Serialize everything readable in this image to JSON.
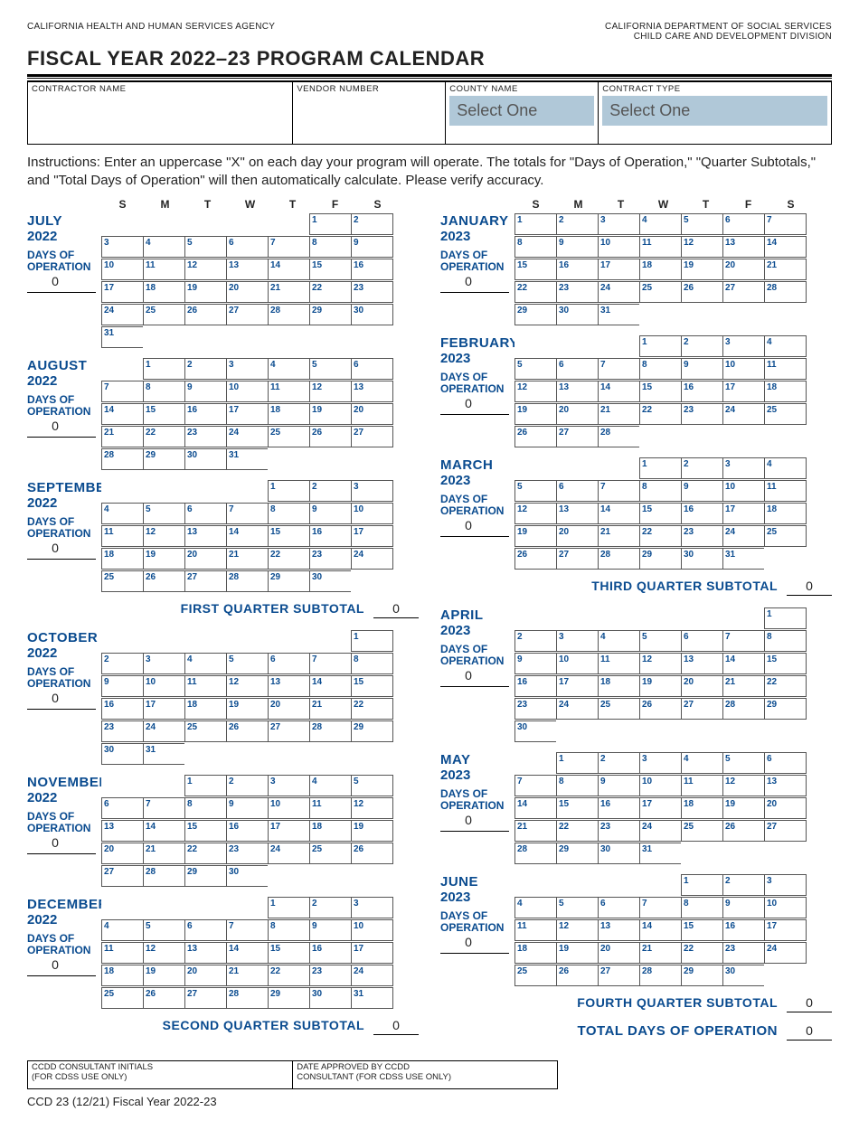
{
  "header": {
    "agency_left": "CALIFORNIA HEALTH AND HUMAN SERVICES AGENCY",
    "agency_right_1": "CALIFORNIA DEPARTMENT OF SOCIAL SERVICES",
    "agency_right_2": "CHILD CARE AND DEVELOPMENT DIVISION"
  },
  "title": "FISCAL YEAR 2022–23 PROGRAM CALENDAR",
  "form_fields": {
    "contractor": "CONTRACTOR NAME",
    "vendor": "VENDOR NUMBER",
    "county": "COUNTY NAME",
    "county_select": "Select One",
    "contract": "CONTRACT TYPE",
    "contract_select": "Select One"
  },
  "instructions": "Instructions: Enter an uppercase \"X\" on each day your program will operate. The totals for \"Days of Operation,\" \"Quarter Subtotals,\" and \"Total Days of Operation\" will then automatically calculate. Please verify accuracy.",
  "dow": [
    "S",
    "M",
    "T",
    "W",
    "T",
    "F",
    "S"
  ],
  "labels": {
    "days_of_operation": "DAYS OF\nOPERATION",
    "q1": "FIRST QUARTER SUBTOTAL",
    "q2": "SECOND QUARTER SUBTOTAL",
    "q3": "THIRD QUARTER SUBTOTAL",
    "q4": "FOURTH QUARTER SUBTOTAL",
    "total": "TOTAL DAYS OF OPERATION"
  },
  "subtotals": {
    "q1": "0",
    "q2": "0",
    "q3": "0",
    "q4": "0",
    "total": "0"
  },
  "months_left": [
    {
      "name": "JULY",
      "year": "2022",
      "days_val": "0",
      "start": 5,
      "ndays": 31
    },
    {
      "name": "AUGUST",
      "year": "2022",
      "days_val": "0",
      "start": 1,
      "ndays": 31
    },
    {
      "name": "SEPTEMBER",
      "year": "2022",
      "days_val": "0",
      "start": 4,
      "ndays": 30
    },
    {
      "name": "OCTOBER",
      "year": "2022",
      "days_val": "0",
      "start": 6,
      "ndays": 31
    },
    {
      "name": "NOVEMBER",
      "year": "2022",
      "days_val": "0",
      "start": 2,
      "ndays": 30
    },
    {
      "name": "DECEMBER",
      "year": "2022",
      "days_val": "0",
      "start": 4,
      "ndays": 31
    }
  ],
  "months_right": [
    {
      "name": "JANUARY",
      "year": "2023",
      "days_val": "0",
      "start": 0,
      "ndays": 31
    },
    {
      "name": "FEBRUARY",
      "year": "2023",
      "days_val": "0",
      "start": 3,
      "ndays": 28
    },
    {
      "name": "MARCH",
      "year": "2023",
      "days_val": "0",
      "start": 3,
      "ndays": 31
    },
    {
      "name": "APRIL",
      "year": "2023",
      "days_val": "0",
      "start": 6,
      "ndays": 30
    },
    {
      "name": "MAY",
      "year": "2023",
      "days_val": "0",
      "start": 1,
      "ndays": 31
    },
    {
      "name": "JUNE",
      "year": "2023",
      "days_val": "0",
      "start": 4,
      "ndays": 30
    }
  ],
  "footer": {
    "c1": "CCDD CONSULTANT INITIALS\n(FOR CDSS USE ONLY)",
    "c2": "DATE APPROVED BY CCDD\nCONSULTANT (FOR CDSS USE ONLY)"
  },
  "form_id": "CCD 23 (12/21) Fiscal Year 2022-23"
}
